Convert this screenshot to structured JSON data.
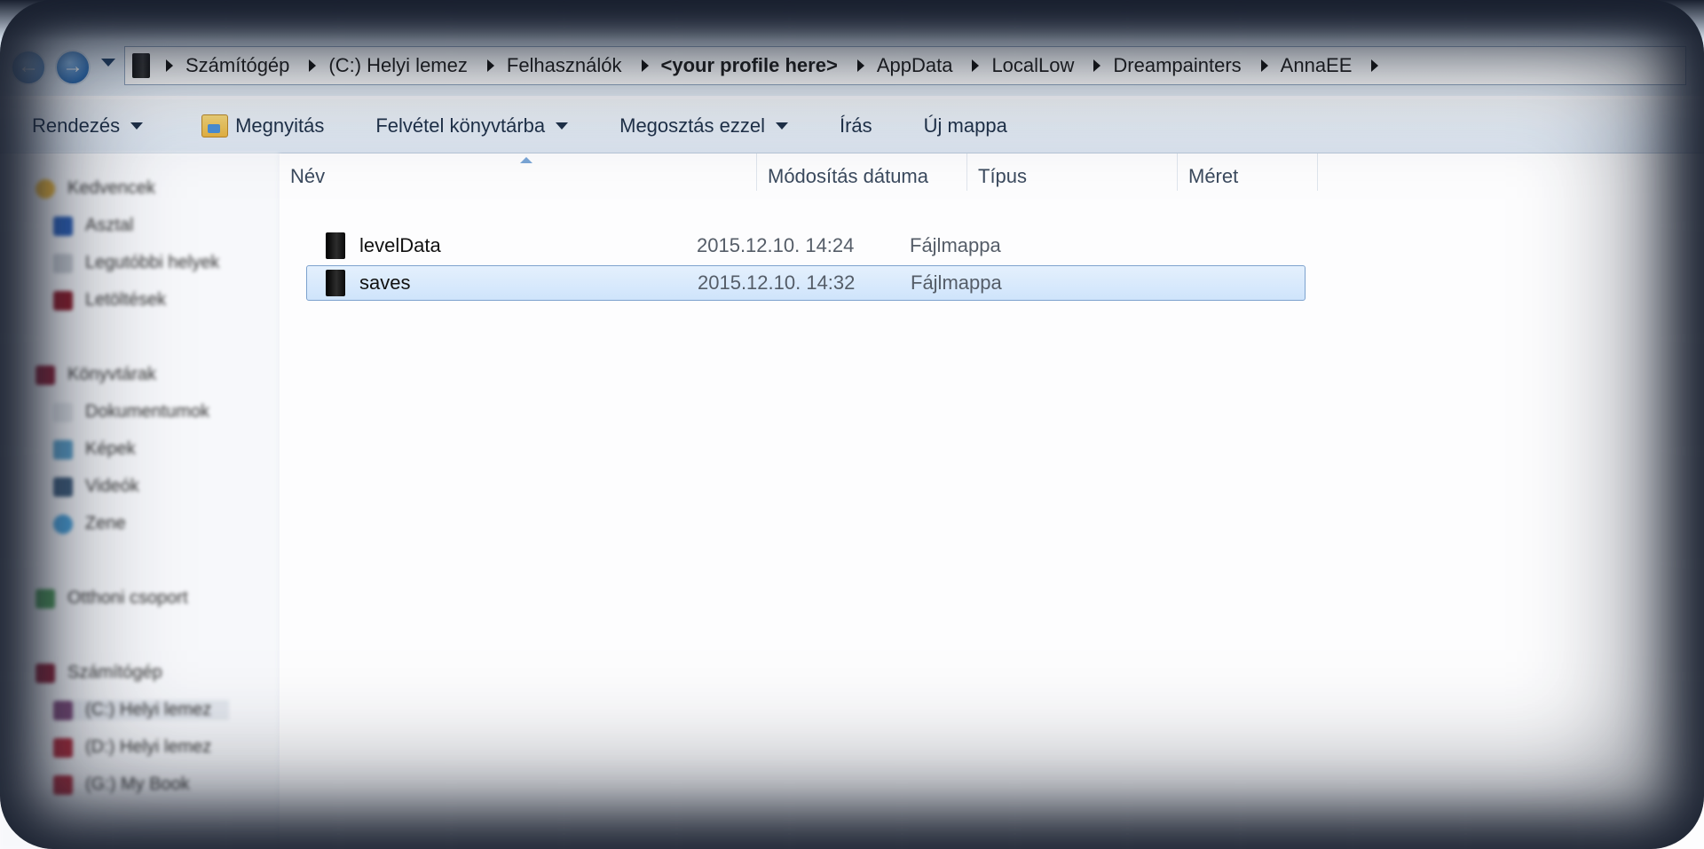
{
  "address_bar": {
    "crumbs": [
      {
        "label": "Számítógép"
      },
      {
        "label": "(C:) Helyi lemez"
      },
      {
        "label": "Felhasználók"
      },
      {
        "label": "<your profile here>"
      },
      {
        "label": "AppData"
      },
      {
        "label": "LocalLow"
      },
      {
        "label": "Dreampainters"
      },
      {
        "label": "AnnaEE"
      }
    ]
  },
  "toolbar": {
    "organize": "Rendezés",
    "open": "Megnyitás",
    "include_in_library": "Felvétel könyvtárba",
    "share_with": "Megosztás ezzel",
    "burn": "Írás",
    "new_folder": "Új mappa"
  },
  "navigation_pane": {
    "favorites": "Kedvencek",
    "favorites_items": [
      "Asztal",
      "Legutóbbi helyek",
      "Letöltések"
    ],
    "libraries": "Könyvtárak",
    "libraries_items": [
      "Dokumentumok",
      "Képek",
      "Videók",
      "Zene"
    ],
    "homegroup": "Otthoni csoport",
    "computer": "Számítógép",
    "computer_items": [
      "(C:) Helyi lemez",
      "(D:) Helyi lemez",
      "(G:) My Book"
    ]
  },
  "columns": {
    "name": "Név",
    "date_modified": "Módosítás dátuma",
    "type": "Típus",
    "size": "Méret"
  },
  "files": [
    {
      "name": "levelData",
      "date": "2015.12.10. 14:24",
      "type": "Fájlmappa",
      "selected": false
    },
    {
      "name": "saves",
      "date": "2015.12.10. 14:32",
      "type": "Fájlmappa",
      "selected": true
    }
  ],
  "colors": {
    "selection_fill": "#cfe4fb",
    "selection_border": "#7da2ce",
    "vignette": "#1a2130"
  }
}
